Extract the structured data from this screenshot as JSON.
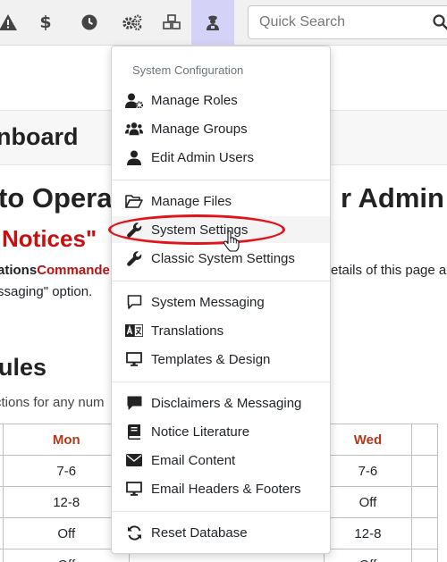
{
  "topbar": {
    "icons": [
      "warning-icon",
      "dollar-icon",
      "clock-icon",
      "cogs-icon",
      "cubes-icon",
      "admin-user-icon"
    ],
    "search_placeholder": "Quick Search"
  },
  "background": {
    "dashboard_title": "nboard",
    "heading_left": "to Opera",
    "heading_right": "r Admin L",
    "notices_title": "Notices\"",
    "line1_a": "ations",
    "line1_b": "Commande",
    "line1_right": "etails of this page a",
    "line2": "ssaging\" option.",
    "rules_title": "ules",
    "line3": "ctions for any num",
    "schedule": {
      "headers": [
        "",
        "Mon",
        "",
        "Wed",
        ""
      ],
      "rows": [
        [
          "",
          "7-6",
          "",
          "7-6",
          ""
        ],
        [
          "",
          "12-8",
          "",
          "Off",
          ""
        ],
        [
          "",
          "Off",
          "",
          "12-8",
          ""
        ],
        [
          "",
          "Off",
          "",
          "Off",
          ""
        ]
      ]
    }
  },
  "menu": {
    "header": "System Configuration",
    "items": [
      {
        "label": "Manage Roles",
        "icon": "user-cog-icon"
      },
      {
        "label": "Manage Groups",
        "icon": "users-icon"
      },
      {
        "label": "Edit Admin Users",
        "icon": "user-icon"
      },
      {
        "label": "Manage Files",
        "icon": "folder-open-icon"
      },
      {
        "label": "System Settings",
        "icon": "wrench-icon"
      },
      {
        "label": "Classic System Settings",
        "icon": "wrench-icon"
      },
      {
        "label": "System Messaging",
        "icon": "comment-icon"
      },
      {
        "label": "Translations",
        "icon": "language-icon"
      },
      {
        "label": "Templates & Design",
        "icon": "desktop-icon"
      },
      {
        "label": "Disclaimers & Messaging",
        "icon": "comment-solid-icon"
      },
      {
        "label": "Notice Literature",
        "icon": "book-icon"
      },
      {
        "label": "Email Content",
        "icon": "envelope-icon"
      },
      {
        "label": "Email Headers & Footers",
        "icon": "desktop-icon"
      },
      {
        "label": "Reset Database",
        "icon": "sync-icon"
      }
    ]
  },
  "colors": {
    "accent_active": "#d4d2f7",
    "highlight_ring": "#e0141a",
    "notice_red": "#c91010"
  }
}
